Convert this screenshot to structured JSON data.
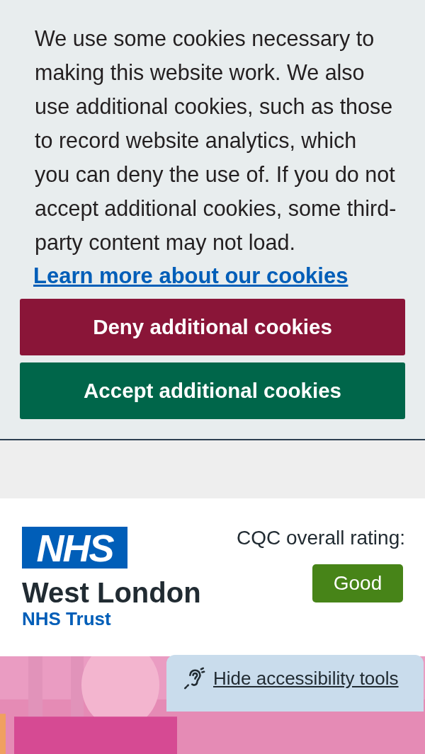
{
  "cookie_banner": {
    "message": "We use some cookies necessary to making this website work. We also use additional cookies, such as those to record website analytics, which you can deny the use of. If you do not accept additional cookies, some third-party content may not load.",
    "link": "Learn more about our cookies",
    "buttons": [
      {
        "label": "Deny additional cookies",
        "kind": "deny"
      },
      {
        "label": "Accept additional cookies",
        "kind": "accept"
      }
    ]
  },
  "header": {
    "logo": {
      "mark": "NHS",
      "name": "West London",
      "subtitle": "NHS Trust"
    },
    "rating_label": "CQC overall rating:",
    "rating": "Good"
  },
  "accessibility": {
    "label": "Hide accessibility tools"
  }
}
